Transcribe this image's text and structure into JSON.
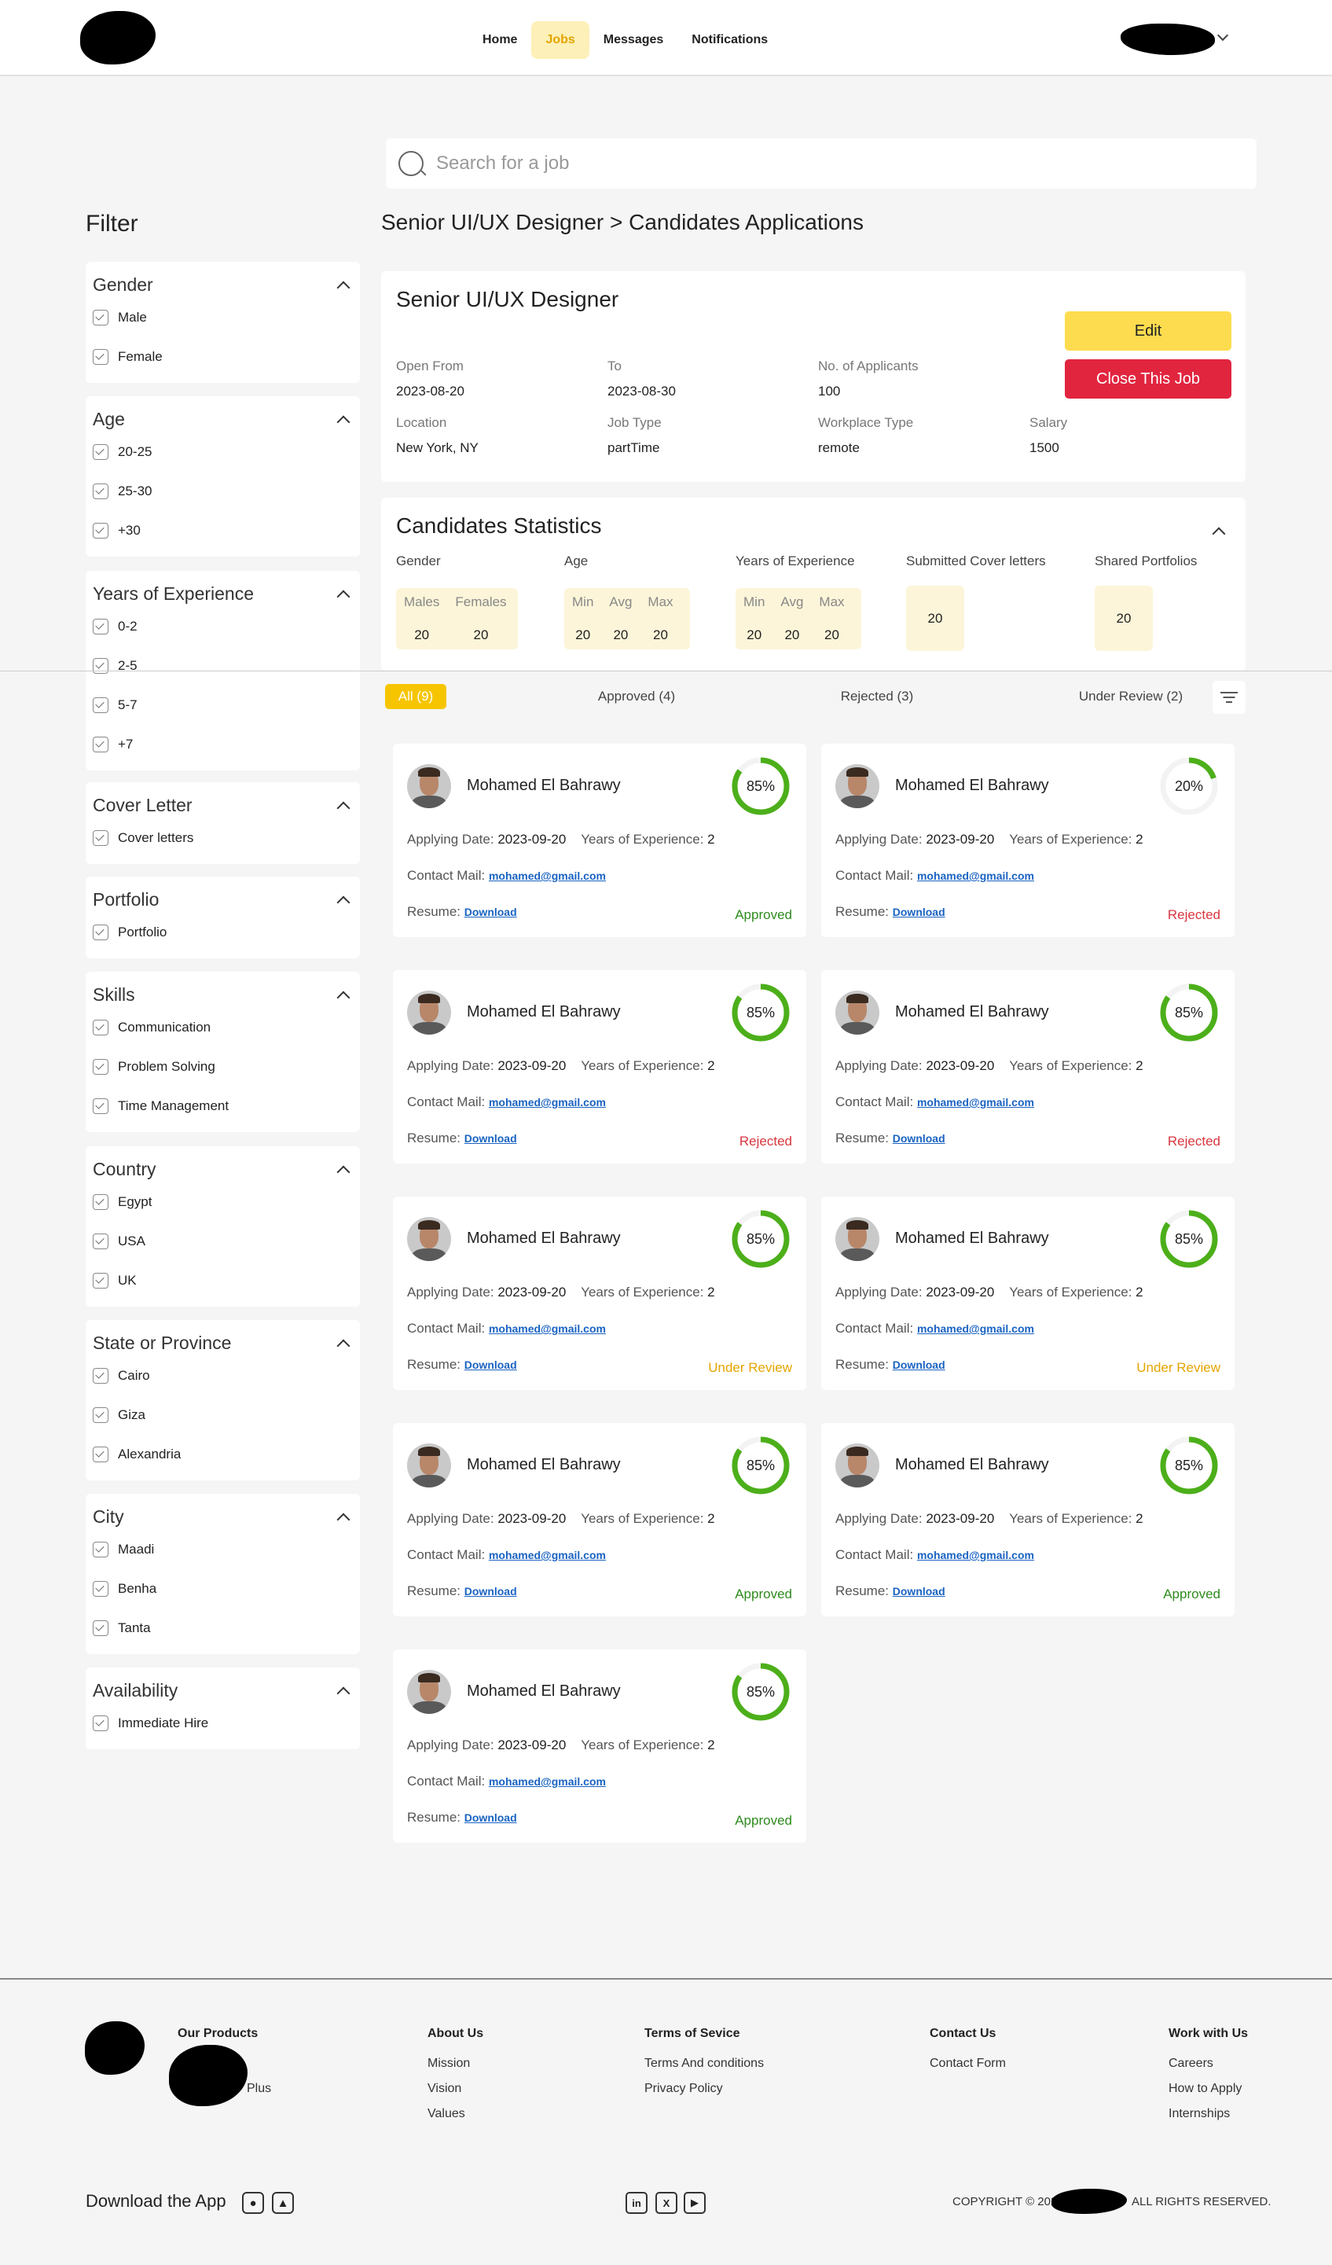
{
  "nav": {
    "items": [
      {
        "label": "Home",
        "active": false
      },
      {
        "label": "Jobs",
        "active": true
      },
      {
        "label": "Messages",
        "active": false
      },
      {
        "label": "Notifications",
        "active": false
      }
    ]
  },
  "search": {
    "placeholder": "Search for a job"
  },
  "filter": {
    "title": "Filter",
    "groups": [
      {
        "title": "Gender",
        "options": [
          "Male",
          "Female"
        ]
      },
      {
        "title": "Age",
        "options": [
          "20-25",
          "25-30",
          "+30"
        ]
      },
      {
        "title": "Years of Experience",
        "options": [
          "0-2",
          "2-5",
          "5-7",
          "+7"
        ]
      },
      {
        "title": "Cover Letter",
        "options": [
          "Cover letters"
        ]
      },
      {
        "title": "Portfolio",
        "options": [
          "Portfolio"
        ]
      },
      {
        "title": "Skills",
        "options": [
          "Communication",
          "Problem Solving",
          "Time Management"
        ]
      },
      {
        "title": "Country",
        "options": [
          "Egypt",
          "USA",
          "UK"
        ]
      },
      {
        "title": "State or Province",
        "options": [
          "Cairo",
          "Giza",
          "Alexandria"
        ]
      },
      {
        "title": "City",
        "options": [
          "Maadi",
          "Benha",
          "Tanta"
        ]
      },
      {
        "title": "Availability",
        "options": [
          "Immediate Hire"
        ]
      }
    ]
  },
  "breadcrumb": "Senior UI/UX Designer > Candidates Applications",
  "job": {
    "title": "Senior UI/UX Designer",
    "open_from_label": "Open From",
    "open_from": "2023-08-20",
    "to_label": "To",
    "to": "2023-08-30",
    "applicants_label": "No. of Applicants",
    "applicants": "100",
    "location_label": "Location",
    "location": "New York, NY",
    "job_type_label": "Job Type",
    "job_type": "partTime",
    "workplace_label": "Workplace Type",
    "workplace": "remote",
    "salary_label": "Salary",
    "salary": "1500",
    "edit_label": "Edit",
    "close_label": "Close This Job"
  },
  "stats": {
    "title": "Candidates Statistics",
    "gender_label": "Gender",
    "males_label": "Males",
    "males": "20",
    "females_label": "Females",
    "females": "20",
    "age_label": "Age",
    "age_min_label": "Min",
    "age_min": "20",
    "age_avg_label": "Avg",
    "age_avg": "20",
    "age_max_label": "Max",
    "age_max": "20",
    "exp_label": "Years of Experience",
    "exp_min_label": "Min",
    "exp_min": "20",
    "exp_avg_label": "Avg",
    "exp_avg": "20",
    "exp_max_label": "Max",
    "exp_max": "20",
    "cover_label": "Submitted Cover letters",
    "cover": "20",
    "portfolio_label": "Shared Portfolios",
    "portfolio": "20"
  },
  "tabs": [
    {
      "label": "All (9)",
      "active": true
    },
    {
      "label": "Approved (4)",
      "active": false
    },
    {
      "label": "Rejected (3)",
      "active": false
    },
    {
      "label": "Under Review (2)",
      "active": false
    }
  ],
  "candidate_labels": {
    "applying_date": "Applying Date:",
    "years": "Years of Experience:",
    "contact": "Contact Mail:",
    "resume": "Resume:",
    "download": "Download"
  },
  "candidates": [
    {
      "name": "Mohamed El Bahrawy",
      "match": 85,
      "match_label": "85%",
      "date": "2023-09-20",
      "years": "2",
      "email": "mohamed@gmail.com",
      "status": "Approved"
    },
    {
      "name": "Mohamed El Bahrawy",
      "match": 20,
      "match_label": "20%",
      "date": "2023-09-20",
      "years": "2",
      "email": "mohamed@gmail.com",
      "status": "Rejected"
    },
    {
      "name": "Mohamed El Bahrawy",
      "match": 85,
      "match_label": "85%",
      "date": "2023-09-20",
      "years": "2",
      "email": "mohamed@gmail.com",
      "status": "Rejected"
    },
    {
      "name": "Mohamed El Bahrawy",
      "match": 85,
      "match_label": "85%",
      "date": "2023-09-20",
      "years": "2",
      "email": "mohamed@gmail.com",
      "status": "Rejected"
    },
    {
      "name": "Mohamed El Bahrawy",
      "match": 85,
      "match_label": "85%",
      "date": "2023-09-20",
      "years": "2",
      "email": "mohamed@gmail.com",
      "status": "Under Review"
    },
    {
      "name": "Mohamed El Bahrawy",
      "match": 85,
      "match_label": "85%",
      "date": "2023-09-20",
      "years": "2",
      "email": "mohamed@gmail.com",
      "status": "Under Review"
    },
    {
      "name": "Mohamed El Bahrawy",
      "match": 85,
      "match_label": "85%",
      "date": "2023-09-20",
      "years": "2",
      "email": "mohamed@gmail.com",
      "status": "Approved"
    },
    {
      "name": "Mohamed El Bahrawy",
      "match": 85,
      "match_label": "85%",
      "date": "2023-09-20",
      "years": "2",
      "email": "mohamed@gmail.com",
      "status": "Approved"
    },
    {
      "name": "Mohamed El Bahrawy",
      "match": 85,
      "match_label": "85%",
      "date": "2023-09-20",
      "years": "2",
      "email": "mohamed@gmail.com",
      "status": "Approved"
    }
  ],
  "status_colors": {
    "Approved": "#2e8b1e",
    "Rejected": "#d9363e",
    "Under Review": "#e5a400"
  },
  "ring_color": "#4caf1a",
  "footer": {
    "products_head": "Our Products",
    "products_plus": "Plus",
    "about_head": "About Us",
    "about_links": [
      "Mission",
      "Vision",
      "Values"
    ],
    "terms_head": "Terms of Sevice",
    "terms_links": [
      "Terms And conditions",
      "Privacy Policy"
    ],
    "contact_head": "Contact Us",
    "contact_links": [
      "Contact Form"
    ],
    "work_head": "Work with Us",
    "work_links": [
      "Careers",
      "How to Apply",
      "Internships"
    ],
    "download_app": "Download the App",
    "copyright_pre": "COPYRIGHT © 202",
    "copyright_post": "ALL RIGHTS RESERVED."
  }
}
